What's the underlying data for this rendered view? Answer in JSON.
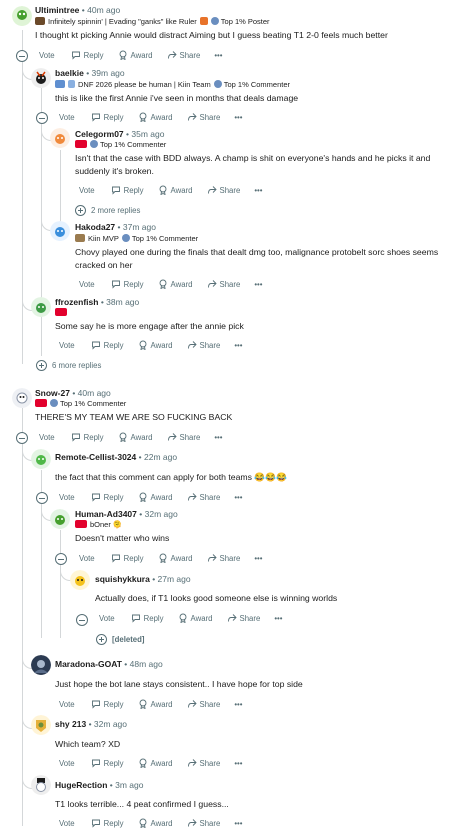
{
  "actions": {
    "vote": "Vote",
    "reply": "Reply",
    "award": "Award",
    "share": "Share"
  },
  "comments": [
    {
      "user": "Ultimintree",
      "time": "40m ago",
      "flair": "Infinitely spinnin' | Evading \"ganks\" like Ruler",
      "badge": "Top 1% Poster",
      "body": "I thought kt picking Annie would distract Aiming but I guess beating T1 2-0 feels much better"
    },
    {
      "user": "baelkie",
      "time": "39m ago",
      "flair": "DNF 2026 please be human | Kiin Team",
      "badge": "Top 1% Commenter",
      "body": "this is like the first Annie i've seen in months that deals damage"
    },
    {
      "user": "Celegorm07",
      "time": "35m ago",
      "flair": "",
      "badge": "Top 1% Commenter",
      "body": "Isn't that the case with BDD always. A champ is shit on everyone's hands and he picks it and suddenly it's broken."
    },
    {
      "user": "Hakoda27",
      "time": "37m ago",
      "flair": "Kiin MVP",
      "badge": "Top 1% Commenter",
      "body": "Chovy played one during the finals that dealt dmg too, malignance protobelt sorc shoes seems cracked on her"
    },
    {
      "user": "ffrozenfish",
      "time": "38m ago",
      "flair": "",
      "badge": "",
      "body": "Some say he is more engage after the annie pick"
    },
    {
      "user": "Snow-27",
      "time": "40m ago",
      "flair": "",
      "badge": "Top 1% Commenter",
      "body": "THERE'S MY TEAM WE ARE SO FUCKING BACK"
    },
    {
      "user": "Remote-Cellist-3024",
      "time": "22m ago",
      "flair": "",
      "badge": "",
      "body": "the fact that this comment can apply for both teams 😂😂😂"
    },
    {
      "user": "Human-Ad3407",
      "time": "32m ago",
      "flair": "bOner 🫠",
      "badge": "",
      "body": "Doesn't matter who wins"
    },
    {
      "user": "squishykkura",
      "time": "27m ago",
      "flair": "",
      "badge": "",
      "body": "Actually does, if T1 looks good someone else is winning worlds"
    },
    {
      "user": "Maradona-GOAT",
      "time": "48m ago",
      "flair": "",
      "badge": "",
      "body": "Just hope the bot lane stays consistent.. I have hope for top side"
    },
    {
      "user": "shy 213",
      "time": "32m ago",
      "flair": "",
      "badge": "",
      "body": "Which team? XD"
    },
    {
      "user": "HugeRection",
      "time": "3m ago",
      "flair": "",
      "badge": "",
      "body": "T1 looks terrible... 4 peat confirmed I guess..."
    }
  ],
  "more_replies_1": "2 more replies",
  "more_replies_2": "6 more replies",
  "deleted_label": "[deleted]",
  "colors": {
    "text": "#1c1c1c",
    "meta": "#576f76",
    "thread": "#d4d7d9",
    "t1_red": "#e2012d"
  }
}
